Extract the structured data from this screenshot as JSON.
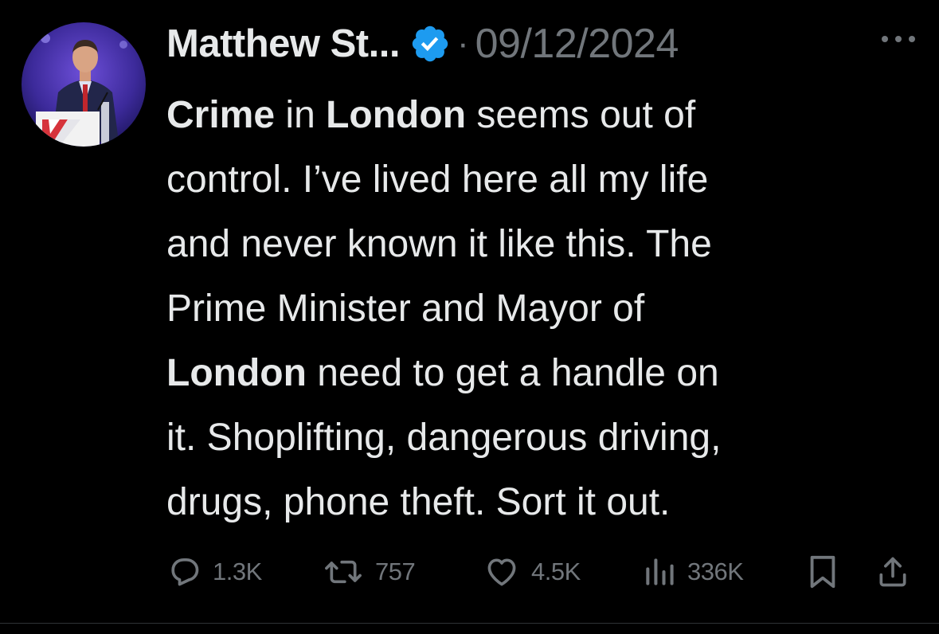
{
  "author": {
    "display_name": "Matthew St...",
    "verified": true
  },
  "post": {
    "separator": "·",
    "timestamp": "09/12/2024",
    "text_lines": [
      [
        {
          "t": "Crime",
          "b": true
        },
        {
          "t": " in ",
          "b": false
        },
        {
          "t": "London",
          "b": true
        },
        {
          "t": " seems out of",
          "b": false
        }
      ],
      [
        {
          "t": "control. I’ve lived here all my life",
          "b": false
        }
      ],
      [
        {
          "t": "and never known it like this. The",
          "b": false
        }
      ],
      [
        {
          "t": "Prime Minister and Mayor of",
          "b": false
        }
      ],
      [
        {
          "t": "London",
          "b": true
        },
        {
          "t": " need to get a handle on",
          "b": false
        }
      ],
      [
        {
          "t": "it. Shoplifting, dangerous driving,",
          "b": false
        }
      ],
      [
        {
          "t": "drugs, phone theft. Sort it out.",
          "b": false
        }
      ]
    ]
  },
  "actions": {
    "replies": "1.3K",
    "reposts": "757",
    "likes": "4.5K",
    "views": "336K"
  },
  "icons": {
    "reply": "reply-icon",
    "repost": "repost-icon",
    "like": "heart-icon",
    "views": "views-icon",
    "bookmark": "bookmark-icon",
    "share": "share-icon",
    "more": "more-icon",
    "verified": "verified-badge-icon"
  },
  "colors": {
    "background": "#000000",
    "text_primary": "#e7e9ea",
    "text_secondary": "#71767b",
    "verified_blue": "#1d9bf0"
  }
}
